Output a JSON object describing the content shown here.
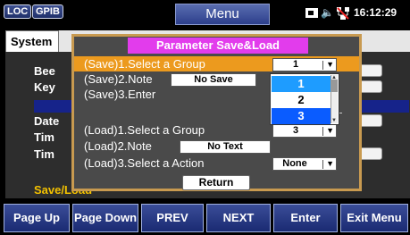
{
  "status_bar": {
    "loc_label": "LOC",
    "gpib_label": "GPIB",
    "menu_title": "Menu",
    "time": "16:12:29",
    "icons": [
      "storage-icon",
      "speaker-icon",
      "network-icon"
    ]
  },
  "background": {
    "tab_label": "System",
    "labels": [
      "Bee",
      "Key",
      "Date",
      "Tim",
      "Tim"
    ],
    "bottom_label": "Save/Load"
  },
  "dialog": {
    "title": "Parameter Save&Load",
    "save_group_label": "(Save)1.Select a Group",
    "save_group_value": "1",
    "save_note_label": "(Save)2.Note",
    "save_note_value": "No Save",
    "save_enter_label": "(Save)3.Enter",
    "load_group_label": "(Load)1.Select a Group",
    "load_group_value": "3",
    "load_note_label": "(Load)2.Note",
    "load_note_value": "No Text",
    "load_action_label": "(Load)3.Select a Action",
    "load_action_value": "None",
    "return_label": "Return"
  },
  "dropdown": {
    "options": [
      "1",
      "2",
      "3"
    ],
    "highlighted": "1",
    "active": "3"
  },
  "softkeys": [
    "Page Up",
    "Page Down",
    "PREV",
    "NEXT",
    "Enter",
    "Exit Menu"
  ]
}
